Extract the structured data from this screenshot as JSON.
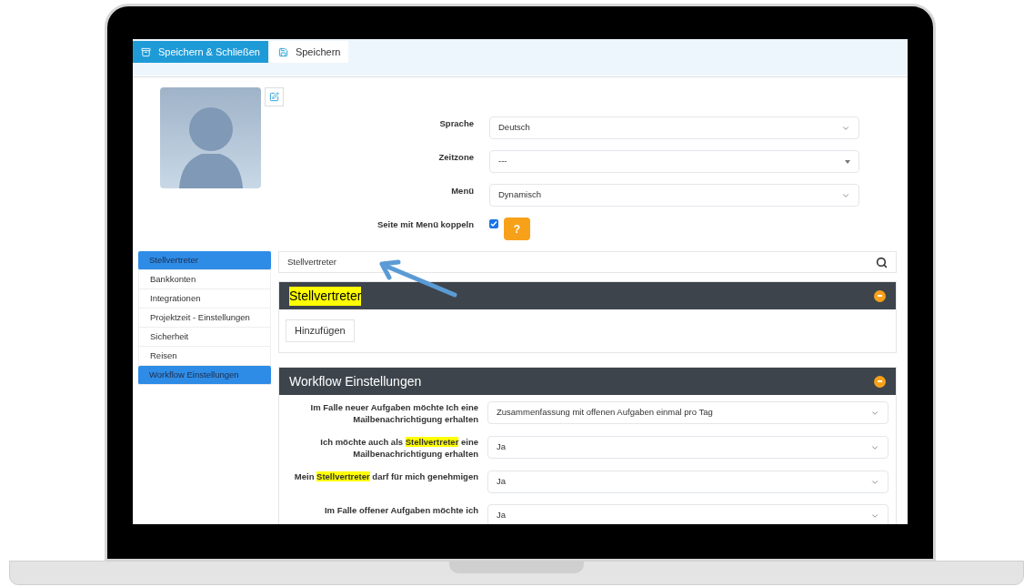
{
  "toolbar": {
    "buttons": [
      {
        "label": "Speichern & Schließen",
        "kind": "primary"
      },
      {
        "label": "Speichern",
        "kind": "secondary"
      }
    ]
  },
  "profile": {
    "fields": [
      {
        "label": "Sprache",
        "kind": "select",
        "value": "Deutsch"
      },
      {
        "label": "Zeitzone",
        "kind": "combo",
        "value": "---"
      },
      {
        "label": "Menü",
        "kind": "select",
        "value": "Dynamisch"
      },
      {
        "label": "Seite mit Menü koppeln",
        "kind": "checkbox",
        "checked": true,
        "help": "?"
      }
    ]
  },
  "sidebar": {
    "items": [
      {
        "label": "Stellvertreter",
        "selected": true
      },
      {
        "label": "Bankkonten",
        "selected": false
      },
      {
        "label": "Integrationen",
        "selected": false
      },
      {
        "label": "Projektzeit - Einstellungen",
        "selected": false
      },
      {
        "label": "Sicherheit",
        "selected": false
      },
      {
        "label": "Reisen",
        "selected": false
      },
      {
        "label": "Workflow Einstellungen",
        "selected": true
      }
    ]
  },
  "search": {
    "value": "Stellvertreter"
  },
  "panels": [
    {
      "title": "Stellvertreter",
      "title_highlighted": true,
      "expanded": true,
      "button": "Hinzufügen"
    },
    {
      "title": "Workflow Einstellungen",
      "title_highlighted": false,
      "expanded": true,
      "rows": [
        {
          "label": [
            {
              "text": "Im Falle neuer Aufgaben möchte Ich eine Mailbenachrichtigung erhalten",
              "highlighted": false
            }
          ],
          "value": "Zusammenfassung mit offenen Aufgaben einmal pro Tag"
        },
        {
          "label": [
            {
              "text": "Ich möchte auch als ",
              "highlighted": false
            },
            {
              "text": "Stellvertreter",
              "highlighted": true
            },
            {
              "text": " eine Mailbenachrichtigung erhalten",
              "highlighted": false
            }
          ],
          "value": "Ja"
        },
        {
          "label": [
            {
              "text": "Mein ",
              "highlighted": false
            },
            {
              "text": "Stellvertreter",
              "highlighted": true
            },
            {
              "text": " darf für mich genehmigen",
              "highlighted": false
            }
          ],
          "value": "Ja"
        },
        {
          "label": [
            {
              "text": "Im Falle offener Aufgaben möchte ich",
              "highlighted": false
            }
          ],
          "value": "Ja"
        }
      ]
    }
  ]
}
